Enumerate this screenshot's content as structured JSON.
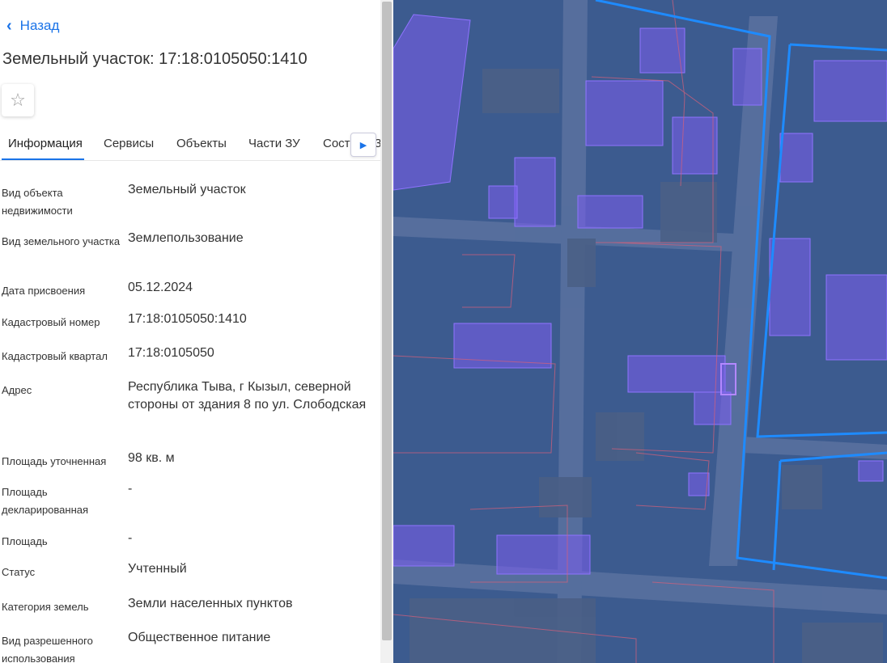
{
  "nav": {
    "back_label": "Назад"
  },
  "title": "Земельный участок: 17:18:0105050:1410",
  "tabs": [
    {
      "label": "Информация"
    },
    {
      "label": "Сервисы"
    },
    {
      "label": "Объекты"
    },
    {
      "label": "Части ЗУ"
    },
    {
      "label": "Состав ЕЗП"
    }
  ],
  "info": [
    {
      "label": "Вид объекта недвижимости",
      "value": "Земельный участок"
    },
    {
      "label": "Вид земельного участка",
      "value": "Землепользование"
    },
    {
      "label": "Дата присвоения",
      "value": "05.12.2024"
    },
    {
      "label": "Кадастровый номер",
      "value": "17:18:0105050:1410"
    },
    {
      "label": "Кадастровый квартал",
      "value": "17:18:0105050"
    },
    {
      "label": "Адрес",
      "value": "Республика Тыва, г Кызыл, северной стороны от здания 8 по ул. Слободская"
    },
    {
      "label": "Площадь уточненная",
      "value": "98 кв. м"
    },
    {
      "label": "Площадь декларированная",
      "value": "-"
    },
    {
      "label": "Площадь",
      "value": "-"
    },
    {
      "label": "Статус",
      "value": "Учтенный"
    },
    {
      "label": "Категория земель",
      "value": "Земли населенных пунктов"
    },
    {
      "label": "Вид разрешенного использования",
      "value": "Общественное питание"
    }
  ],
  "colors": {
    "accent": "#1a73e8",
    "map_base": "#3c5b8f",
    "building_overlay": "#7b5cf0",
    "boundary_line": "#1e8bff"
  }
}
